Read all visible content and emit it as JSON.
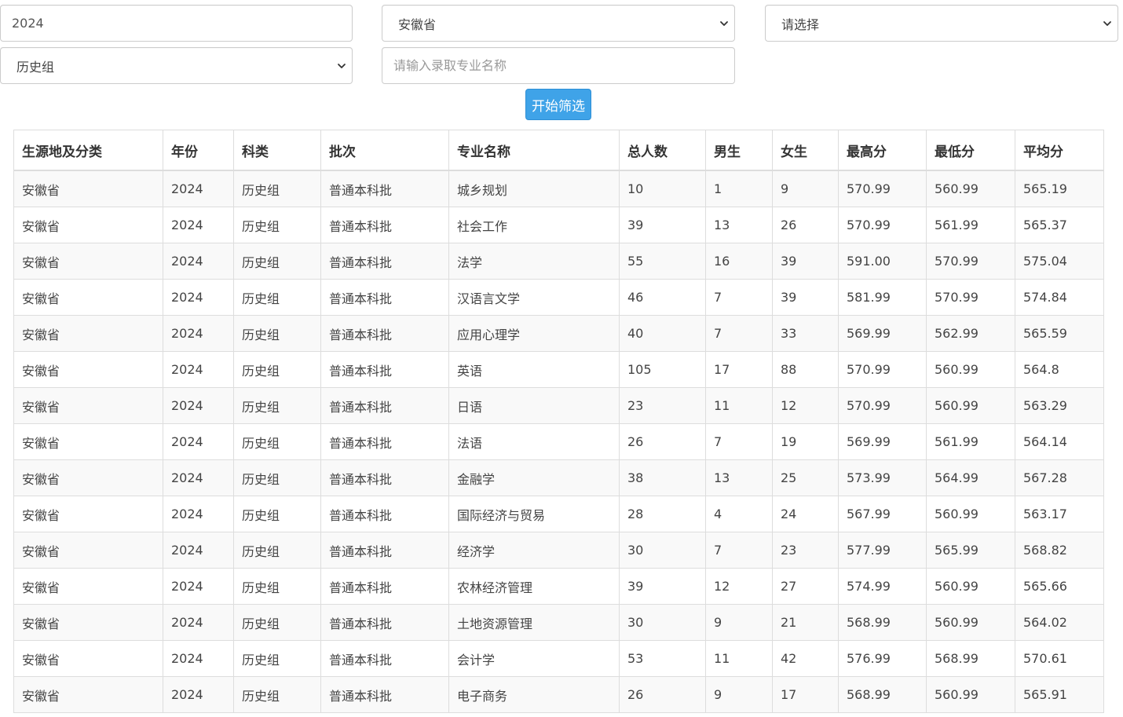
{
  "filters": {
    "year": {
      "value": "2024"
    },
    "province": {
      "selected": "安徽省"
    },
    "type": {
      "selected": "请选择"
    },
    "subject": {
      "selected": "历史组"
    },
    "major": {
      "placeholder": "请输入录取专业名称",
      "value": ""
    }
  },
  "filter_button": {
    "label": "开始筛选",
    "color": "#3fa3e8"
  },
  "table": {
    "headers": [
      "生源地及分类",
      "年份",
      "科类",
      "批次",
      "专业名称",
      "总人数",
      "男生",
      "女生",
      "最高分",
      "最低分",
      "平均分"
    ],
    "rows": [
      [
        "安徽省",
        "2024",
        "历史组",
        "普通本科批",
        "城乡规划",
        "10",
        "1",
        "9",
        "570.99",
        "560.99",
        "565.19"
      ],
      [
        "安徽省",
        "2024",
        "历史组",
        "普通本科批",
        "社会工作",
        "39",
        "13",
        "26",
        "570.99",
        "561.99",
        "565.37"
      ],
      [
        "安徽省",
        "2024",
        "历史组",
        "普通本科批",
        "法学",
        "55",
        "16",
        "39",
        "591.00",
        "570.99",
        "575.04"
      ],
      [
        "安徽省",
        "2024",
        "历史组",
        "普通本科批",
        "汉语言文学",
        "46",
        "7",
        "39",
        "581.99",
        "570.99",
        "574.84"
      ],
      [
        "安徽省",
        "2024",
        "历史组",
        "普通本科批",
        "应用心理学",
        "40",
        "7",
        "33",
        "569.99",
        "562.99",
        "565.59"
      ],
      [
        "安徽省",
        "2024",
        "历史组",
        "普通本科批",
        "英语",
        "105",
        "17",
        "88",
        "570.99",
        "560.99",
        "564.8"
      ],
      [
        "安徽省",
        "2024",
        "历史组",
        "普通本科批",
        "日语",
        "23",
        "11",
        "12",
        "570.99",
        "560.99",
        "563.29"
      ],
      [
        "安徽省",
        "2024",
        "历史组",
        "普通本科批",
        "法语",
        "26",
        "7",
        "19",
        "569.99",
        "561.99",
        "564.14"
      ],
      [
        "安徽省",
        "2024",
        "历史组",
        "普通本科批",
        "金融学",
        "38",
        "13",
        "25",
        "573.99",
        "564.99",
        "567.28"
      ],
      [
        "安徽省",
        "2024",
        "历史组",
        "普通本科批",
        "国际经济与贸易",
        "28",
        "4",
        "24",
        "567.99",
        "560.99",
        "563.17"
      ],
      [
        "安徽省",
        "2024",
        "历史组",
        "普通本科批",
        "经济学",
        "30",
        "7",
        "23",
        "577.99",
        "565.99",
        "568.82"
      ],
      [
        "安徽省",
        "2024",
        "历史组",
        "普通本科批",
        "农林经济管理",
        "39",
        "12",
        "27",
        "574.99",
        "560.99",
        "565.66"
      ],
      [
        "安徽省",
        "2024",
        "历史组",
        "普通本科批",
        "土地资源管理",
        "30",
        "9",
        "21",
        "568.99",
        "560.99",
        "564.02"
      ],
      [
        "安徽省",
        "2024",
        "历史组",
        "普通本科批",
        "会计学",
        "53",
        "11",
        "42",
        "576.99",
        "568.99",
        "570.61"
      ],
      [
        "安徽省",
        "2024",
        "历史组",
        "普通本科批",
        "电子商务",
        "26",
        "9",
        "17",
        "568.99",
        "560.99",
        "565.91"
      ]
    ]
  },
  "icons": {
    "select_arrow": "chevron-down-icon"
  }
}
